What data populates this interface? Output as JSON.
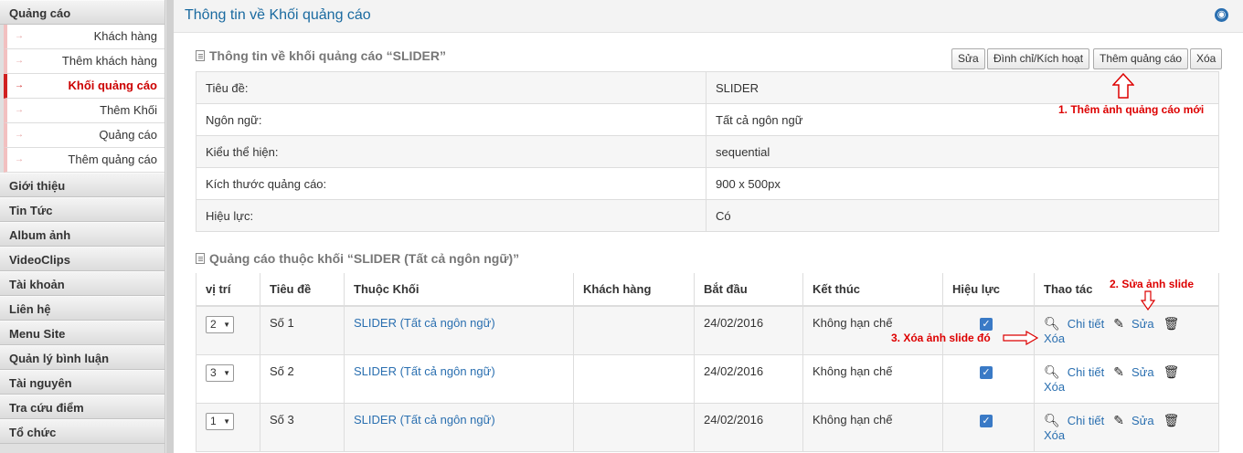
{
  "sidebar": {
    "group_ads": "Quảng cáo",
    "sub_items": [
      "Khách hàng",
      "Thêm khách hàng",
      "Khối quảng cáo",
      "Thêm Khối",
      "Quảng cáo",
      "Thêm quảng cáo"
    ],
    "active_index": 2,
    "groups": [
      "Giới thiệu",
      "Tin Tức",
      "Album ảnh",
      "VideoClips",
      "Tài khoản",
      "Liên hệ",
      "Menu Site",
      "Quản lý bình luận",
      "Tài nguyên",
      "Tra cứu điểm",
      "Tổ chức"
    ]
  },
  "header": {
    "title": "Thông tin về Khối quảng cáo"
  },
  "info": {
    "section_title": "Thông tin về khối quảng cáo “SLIDER”",
    "buttons": {
      "edit": "Sửa",
      "suspend": "Đình chỉ/Kích hoạt",
      "add_ad": "Thêm quảng cáo",
      "delete": "Xóa"
    },
    "rows": [
      {
        "key": "Tiêu đề:",
        "value": "SLIDER"
      },
      {
        "key": "Ngôn ngữ:",
        "value": "Tất cả ngôn ngữ"
      },
      {
        "key": "Kiểu thể hiện:",
        "value": "sequential"
      },
      {
        "key": "Kích thước quảng cáo:",
        "value": "900 x 500px"
      },
      {
        "key": "Hiệu lực:",
        "value": "Có"
      }
    ]
  },
  "ads": {
    "section_title": "Quảng cáo thuộc khối “SLIDER (Tất cả ngôn ngữ)”",
    "columns": [
      "vị trí",
      "Tiêu đề",
      "Thuộc Khối",
      "Khách hàng",
      "Bắt đầu",
      "Kết thúc",
      "Hiệu lực",
      "Thao tác"
    ],
    "rows": [
      {
        "position": "2",
        "title": "Số 1",
        "block": "SLIDER (Tất cả ngôn ngữ)",
        "customer": "",
        "start": "24/02/2016",
        "end": "Không hạn chế",
        "detail": "Chi tiết",
        "edit": "Sửa",
        "delete": "Xóa"
      },
      {
        "position": "3",
        "title": "Số 2",
        "block": "SLIDER (Tất cả ngôn ngữ)",
        "customer": "",
        "start": "24/02/2016",
        "end": "Không hạn chế",
        "detail": "Chi tiết",
        "edit": "Sửa",
        "delete": "Xóa"
      },
      {
        "position": "1",
        "title": "Số 3",
        "block": "SLIDER (Tất cả ngôn ngữ)",
        "customer": "",
        "start": "24/02/2016",
        "end": "Không hạn chế",
        "detail": "Chi tiết",
        "edit": "Sửa",
        "delete": "Xóa"
      }
    ]
  },
  "annotations": {
    "add_new": "1. Thêm ảnh quảng cáo mới",
    "edit_slide": "2. Sửa ảnh slide",
    "delete_slide": "3. Xóa ảnh slide đó"
  },
  "colors": {
    "title_blue": "#1a6aa0",
    "link_blue": "#2a6fb0",
    "active_red": "#cc0000",
    "annotation_red": "#dd0000"
  }
}
